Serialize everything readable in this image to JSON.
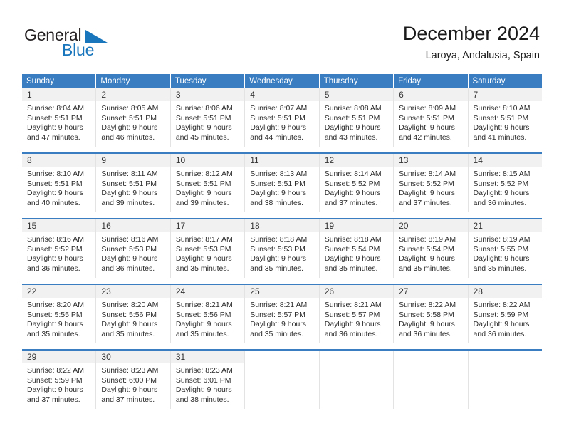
{
  "brand": {
    "name_part1": "General",
    "name_part2": "Blue",
    "triangle_icon": "triangle-icon",
    "color_black": "#231f20",
    "color_blue": "#1a76bc"
  },
  "header": {
    "title": "December 2024",
    "subtitle": "Laroya, Andalusia, Spain"
  },
  "calendar": {
    "accent_color": "#3a7dc0",
    "daynum_bg": "#f1f1f1",
    "weekdays": [
      "Sunday",
      "Monday",
      "Tuesday",
      "Wednesday",
      "Thursday",
      "Friday",
      "Saturday"
    ],
    "weeks": [
      [
        {
          "day": "1",
          "sunrise": "Sunrise: 8:04 AM",
          "sunset": "Sunset: 5:51 PM",
          "daylight1": "Daylight: 9 hours",
          "daylight2": "and 47 minutes."
        },
        {
          "day": "2",
          "sunrise": "Sunrise: 8:05 AM",
          "sunset": "Sunset: 5:51 PM",
          "daylight1": "Daylight: 9 hours",
          "daylight2": "and 46 minutes."
        },
        {
          "day": "3",
          "sunrise": "Sunrise: 8:06 AM",
          "sunset": "Sunset: 5:51 PM",
          "daylight1": "Daylight: 9 hours",
          "daylight2": "and 45 minutes."
        },
        {
          "day": "4",
          "sunrise": "Sunrise: 8:07 AM",
          "sunset": "Sunset: 5:51 PM",
          "daylight1": "Daylight: 9 hours",
          "daylight2": "and 44 minutes."
        },
        {
          "day": "5",
          "sunrise": "Sunrise: 8:08 AM",
          "sunset": "Sunset: 5:51 PM",
          "daylight1": "Daylight: 9 hours",
          "daylight2": "and 43 minutes."
        },
        {
          "day": "6",
          "sunrise": "Sunrise: 8:09 AM",
          "sunset": "Sunset: 5:51 PM",
          "daylight1": "Daylight: 9 hours",
          "daylight2": "and 42 minutes."
        },
        {
          "day": "7",
          "sunrise": "Sunrise: 8:10 AM",
          "sunset": "Sunset: 5:51 PM",
          "daylight1": "Daylight: 9 hours",
          "daylight2": "and 41 minutes."
        }
      ],
      [
        {
          "day": "8",
          "sunrise": "Sunrise: 8:10 AM",
          "sunset": "Sunset: 5:51 PM",
          "daylight1": "Daylight: 9 hours",
          "daylight2": "and 40 minutes."
        },
        {
          "day": "9",
          "sunrise": "Sunrise: 8:11 AM",
          "sunset": "Sunset: 5:51 PM",
          "daylight1": "Daylight: 9 hours",
          "daylight2": "and 39 minutes."
        },
        {
          "day": "10",
          "sunrise": "Sunrise: 8:12 AM",
          "sunset": "Sunset: 5:51 PM",
          "daylight1": "Daylight: 9 hours",
          "daylight2": "and 39 minutes."
        },
        {
          "day": "11",
          "sunrise": "Sunrise: 8:13 AM",
          "sunset": "Sunset: 5:51 PM",
          "daylight1": "Daylight: 9 hours",
          "daylight2": "and 38 minutes."
        },
        {
          "day": "12",
          "sunrise": "Sunrise: 8:14 AM",
          "sunset": "Sunset: 5:52 PM",
          "daylight1": "Daylight: 9 hours",
          "daylight2": "and 37 minutes."
        },
        {
          "day": "13",
          "sunrise": "Sunrise: 8:14 AM",
          "sunset": "Sunset: 5:52 PM",
          "daylight1": "Daylight: 9 hours",
          "daylight2": "and 37 minutes."
        },
        {
          "day": "14",
          "sunrise": "Sunrise: 8:15 AM",
          "sunset": "Sunset: 5:52 PM",
          "daylight1": "Daylight: 9 hours",
          "daylight2": "and 36 minutes."
        }
      ],
      [
        {
          "day": "15",
          "sunrise": "Sunrise: 8:16 AM",
          "sunset": "Sunset: 5:52 PM",
          "daylight1": "Daylight: 9 hours",
          "daylight2": "and 36 minutes."
        },
        {
          "day": "16",
          "sunrise": "Sunrise: 8:16 AM",
          "sunset": "Sunset: 5:53 PM",
          "daylight1": "Daylight: 9 hours",
          "daylight2": "and 36 minutes."
        },
        {
          "day": "17",
          "sunrise": "Sunrise: 8:17 AM",
          "sunset": "Sunset: 5:53 PM",
          "daylight1": "Daylight: 9 hours",
          "daylight2": "and 35 minutes."
        },
        {
          "day": "18",
          "sunrise": "Sunrise: 8:18 AM",
          "sunset": "Sunset: 5:53 PM",
          "daylight1": "Daylight: 9 hours",
          "daylight2": "and 35 minutes."
        },
        {
          "day": "19",
          "sunrise": "Sunrise: 8:18 AM",
          "sunset": "Sunset: 5:54 PM",
          "daylight1": "Daylight: 9 hours",
          "daylight2": "and 35 minutes."
        },
        {
          "day": "20",
          "sunrise": "Sunrise: 8:19 AM",
          "sunset": "Sunset: 5:54 PM",
          "daylight1": "Daylight: 9 hours",
          "daylight2": "and 35 minutes."
        },
        {
          "day": "21",
          "sunrise": "Sunrise: 8:19 AM",
          "sunset": "Sunset: 5:55 PM",
          "daylight1": "Daylight: 9 hours",
          "daylight2": "and 35 minutes."
        }
      ],
      [
        {
          "day": "22",
          "sunrise": "Sunrise: 8:20 AM",
          "sunset": "Sunset: 5:55 PM",
          "daylight1": "Daylight: 9 hours",
          "daylight2": "and 35 minutes."
        },
        {
          "day": "23",
          "sunrise": "Sunrise: 8:20 AM",
          "sunset": "Sunset: 5:56 PM",
          "daylight1": "Daylight: 9 hours",
          "daylight2": "and 35 minutes."
        },
        {
          "day": "24",
          "sunrise": "Sunrise: 8:21 AM",
          "sunset": "Sunset: 5:56 PM",
          "daylight1": "Daylight: 9 hours",
          "daylight2": "and 35 minutes."
        },
        {
          "day": "25",
          "sunrise": "Sunrise: 8:21 AM",
          "sunset": "Sunset: 5:57 PM",
          "daylight1": "Daylight: 9 hours",
          "daylight2": "and 35 minutes."
        },
        {
          "day": "26",
          "sunrise": "Sunrise: 8:21 AM",
          "sunset": "Sunset: 5:57 PM",
          "daylight1": "Daylight: 9 hours",
          "daylight2": "and 36 minutes."
        },
        {
          "day": "27",
          "sunrise": "Sunrise: 8:22 AM",
          "sunset": "Sunset: 5:58 PM",
          "daylight1": "Daylight: 9 hours",
          "daylight2": "and 36 minutes."
        },
        {
          "day": "28",
          "sunrise": "Sunrise: 8:22 AM",
          "sunset": "Sunset: 5:59 PM",
          "daylight1": "Daylight: 9 hours",
          "daylight2": "and 36 minutes."
        }
      ],
      [
        {
          "day": "29",
          "sunrise": "Sunrise: 8:22 AM",
          "sunset": "Sunset: 5:59 PM",
          "daylight1": "Daylight: 9 hours",
          "daylight2": "and 37 minutes."
        },
        {
          "day": "30",
          "sunrise": "Sunrise: 8:23 AM",
          "sunset": "Sunset: 6:00 PM",
          "daylight1": "Daylight: 9 hours",
          "daylight2": "and 37 minutes."
        },
        {
          "day": "31",
          "sunrise": "Sunrise: 8:23 AM",
          "sunset": "Sunset: 6:01 PM",
          "daylight1": "Daylight: 9 hours",
          "daylight2": "and 38 minutes."
        },
        {
          "day": "",
          "sunrise": "",
          "sunset": "",
          "daylight1": "",
          "daylight2": ""
        },
        {
          "day": "",
          "sunrise": "",
          "sunset": "",
          "daylight1": "",
          "daylight2": ""
        },
        {
          "day": "",
          "sunrise": "",
          "sunset": "",
          "daylight1": "",
          "daylight2": ""
        },
        {
          "day": "",
          "sunrise": "",
          "sunset": "",
          "daylight1": "",
          "daylight2": ""
        }
      ]
    ]
  }
}
